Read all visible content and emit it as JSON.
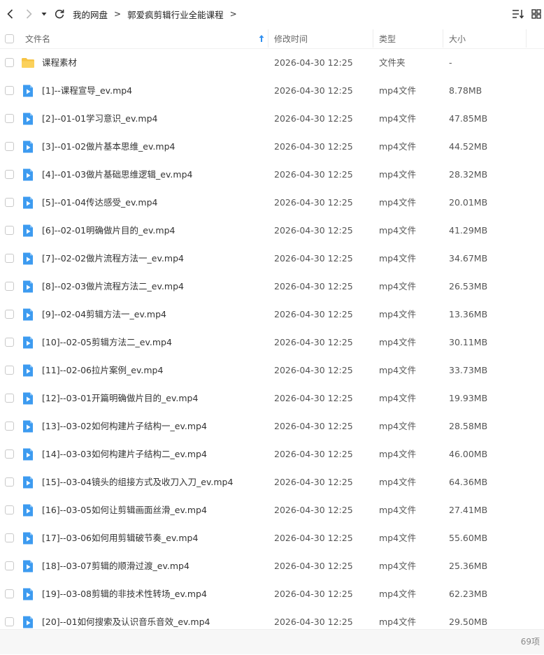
{
  "breadcrumb": {
    "items": [
      "我的网盘",
      "郭爱疯剪辑行业全能课程"
    ]
  },
  "header": {
    "name": "文件名",
    "mtime": "修改时间",
    "type": "类型",
    "size": "大小"
  },
  "files": [
    {
      "icon": "folder-icon",
      "name": "课程素材",
      "mtime": "2026-04-30 12:25",
      "type": "文件夹",
      "size": "-"
    },
    {
      "icon": "video-file-icon",
      "name": "[1]--课程宣导_ev.mp4",
      "mtime": "2026-04-30 12:25",
      "type": "mp4文件",
      "size": "8.78MB"
    },
    {
      "icon": "video-file-icon",
      "name": "[2]--01-01学习意识_ev.mp4",
      "mtime": "2026-04-30 12:25",
      "type": "mp4文件",
      "size": "47.85MB"
    },
    {
      "icon": "video-file-icon",
      "name": "[3]--01-02做片基本思维_ev.mp4",
      "mtime": "2026-04-30 12:25",
      "type": "mp4文件",
      "size": "44.52MB"
    },
    {
      "icon": "video-file-icon",
      "name": "[4]--01-03做片基础思维逻辑_ev.mp4",
      "mtime": "2026-04-30 12:25",
      "type": "mp4文件",
      "size": "28.32MB"
    },
    {
      "icon": "video-file-icon",
      "name": "[5]--01-04传达感受_ev.mp4",
      "mtime": "2026-04-30 12:25",
      "type": "mp4文件",
      "size": "20.01MB"
    },
    {
      "icon": "video-file-icon",
      "name": "[6]--02-01明确做片目的_ev.mp4",
      "mtime": "2026-04-30 12:25",
      "type": "mp4文件",
      "size": "41.29MB"
    },
    {
      "icon": "video-file-icon",
      "name": "[7]--02-02做片流程方法一_ev.mp4",
      "mtime": "2026-04-30 12:25",
      "type": "mp4文件",
      "size": "34.67MB"
    },
    {
      "icon": "video-file-icon",
      "name": "[8]--02-03做片流程方法二_ev.mp4",
      "mtime": "2026-04-30 12:25",
      "type": "mp4文件",
      "size": "26.53MB"
    },
    {
      "icon": "video-file-icon",
      "name": "[9]--02-04剪辑方法一_ev.mp4",
      "mtime": "2026-04-30 12:25",
      "type": "mp4文件",
      "size": "13.36MB"
    },
    {
      "icon": "video-file-icon",
      "name": "[10]--02-05剪辑方法二_ev.mp4",
      "mtime": "2026-04-30 12:25",
      "type": "mp4文件",
      "size": "30.11MB"
    },
    {
      "icon": "video-file-icon",
      "name": "[11]--02-06拉片案例_ev.mp4",
      "mtime": "2026-04-30 12:25",
      "type": "mp4文件",
      "size": "33.73MB"
    },
    {
      "icon": "video-file-icon",
      "name": "[12]--03-01开篇明确做片目的_ev.mp4",
      "mtime": "2026-04-30 12:25",
      "type": "mp4文件",
      "size": "19.93MB"
    },
    {
      "icon": "video-file-icon",
      "name": "[13]--03-02如何构建片子结构一_ev.mp4",
      "mtime": "2026-04-30 12:25",
      "type": "mp4文件",
      "size": "28.58MB"
    },
    {
      "icon": "video-file-icon",
      "name": "[14]--03-03如何构建片子结构二_ev.mp4",
      "mtime": "2026-04-30 12:25",
      "type": "mp4文件",
      "size": "46.00MB"
    },
    {
      "icon": "video-file-icon",
      "name": "[15]--03-04镜头的组接方式及收刀入刀_ev.mp4",
      "mtime": "2026-04-30 12:25",
      "type": "mp4文件",
      "size": "64.36MB"
    },
    {
      "icon": "video-file-icon",
      "name": "[16]--03-05如何让剪辑画面丝滑_ev.mp4",
      "mtime": "2026-04-30 12:25",
      "type": "mp4文件",
      "size": "27.41MB"
    },
    {
      "icon": "video-file-icon",
      "name": "[17]--03-06如何用剪辑破节奏_ev.mp4",
      "mtime": "2026-04-30 12:25",
      "type": "mp4文件",
      "size": "55.60MB"
    },
    {
      "icon": "video-file-icon",
      "name": "[18]--03-07剪辑的顺滑过渡_ev.mp4",
      "mtime": "2026-04-30 12:25",
      "type": "mp4文件",
      "size": "25.36MB"
    },
    {
      "icon": "video-file-icon",
      "name": "[19]--03-08剪辑的非技术性转场_ev.mp4",
      "mtime": "2026-04-30 12:25",
      "type": "mp4文件",
      "size": "62.23MB"
    },
    {
      "icon": "video-file-icon",
      "name": "[20]--01如何搜索及认识音乐音效_ev.mp4",
      "mtime": "2026-04-30 12:25",
      "type": "mp4文件",
      "size": "29.50MB"
    }
  ],
  "footer": {
    "count": "69项"
  },
  "colors": {
    "folder": "#f7c444",
    "video": "#3d9bf0",
    "sort_arrow": "#2f8ff0"
  }
}
